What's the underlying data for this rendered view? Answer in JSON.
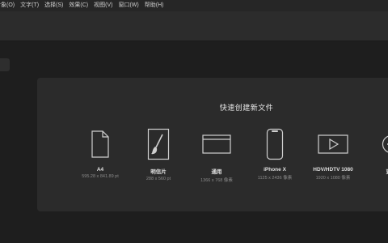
{
  "menubar": {
    "items": [
      "对象(O)",
      "文字(T)",
      "选择(S)",
      "效果(C)",
      "视图(V)",
      "窗口(W)",
      "帮助(H)"
    ]
  },
  "home": {
    "title": "快速创建新文件",
    "presets": [
      {
        "name": "A4",
        "dims": "595.28 x 841.89 pt",
        "icon": "document-icon"
      },
      {
        "name": "明信片",
        "dims": "288 x 560 pt",
        "icon": "postcard-brush-icon"
      },
      {
        "name": "通用",
        "dims": "1366 x 768 像素",
        "icon": "browser-window-icon"
      },
      {
        "name": "iPhone X",
        "dims": "1125 x 2436 像素",
        "icon": "phone-icon"
      },
      {
        "name": "HDV/HDTV 1080",
        "dims": "1920 x 1080 像素",
        "icon": "video-play-icon"
      },
      {
        "name": "更多",
        "dims": "",
        "icon": "more-presets-icon"
      }
    ]
  },
  "colors": {
    "menubar_bg": "#262626",
    "toolbar_bg": "#2c2c2c",
    "canvas_bg": "#1e1e1e",
    "card_bg": "#2b2b2b",
    "icon_stroke": "#cfcfcf"
  }
}
